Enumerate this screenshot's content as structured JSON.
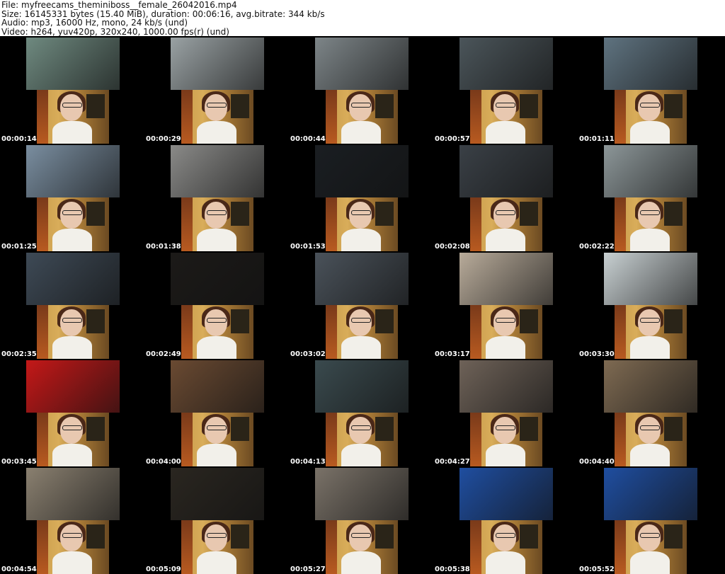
{
  "header": {
    "file": "File: myfreecams_theminiboss__female_26042016.mp4",
    "size": "Size: 16145331 bytes (15.40 MiB), duration: 00:06:16, avg.bitrate: 344 kb/s",
    "audio": "Audio: mp3, 16000 Hz, mono, 24 kb/s (und)",
    "video": "Video: h264, yuv420p, 320x240, 1000.00 fps(r) (und)"
  },
  "thumbnails": [
    {
      "time": "00:00:14",
      "scene": "#6f8a80"
    },
    {
      "time": "00:00:29",
      "scene": "#9aa2a4"
    },
    {
      "time": "00:00:44",
      "scene": "#7d8588"
    },
    {
      "time": "00:00:57",
      "scene": "#4b555a"
    },
    {
      "time": "00:01:11",
      "scene": "#5f7380"
    },
    {
      "time": "00:01:25",
      "scene": "#7a8ea0"
    },
    {
      "time": "00:01:38",
      "scene": "#8a8a88"
    },
    {
      "time": "00:01:53",
      "scene": "#1a1e22"
    },
    {
      "time": "00:02:08",
      "scene": "#3a4046"
    },
    {
      "time": "00:02:22",
      "scene": "#8c9698"
    },
    {
      "time": "00:02:35",
      "scene": "#3e4a56"
    },
    {
      "time": "00:02:49",
      "scene": "#1c1a18"
    },
    {
      "time": "00:03:02",
      "scene": "#4a525a"
    },
    {
      "time": "00:03:17",
      "scene": "#b8ab9a"
    },
    {
      "time": "00:03:30",
      "scene": "#c8d0d2"
    },
    {
      "time": "00:03:45",
      "scene": "#c41818"
    },
    {
      "time": "00:04:00",
      "scene": "#6a4a32"
    },
    {
      "time": "00:04:13",
      "scene": "#3a4a4e"
    },
    {
      "time": "00:04:27",
      "scene": "#6e6258"
    },
    {
      "time": "00:04:40",
      "scene": "#7e6a52"
    },
    {
      "time": "00:04:54",
      "scene": "#8a8070"
    },
    {
      "time": "00:05:09",
      "scene": "#2a2620"
    },
    {
      "time": "00:05:27",
      "scene": "#7a7268"
    },
    {
      "time": "00:05:38",
      "scene": "#1f4ea0"
    },
    {
      "time": "00:05:52",
      "scene": "#1f4ea0"
    }
  ]
}
